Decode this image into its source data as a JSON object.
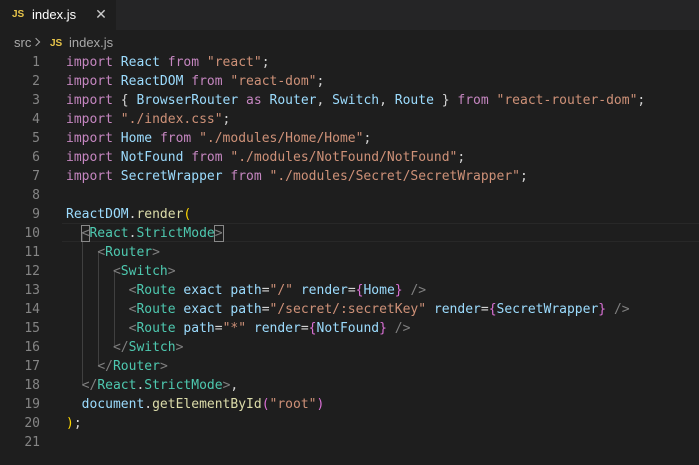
{
  "tab": {
    "icon_text": "JS",
    "label": "index.js",
    "close": "✕"
  },
  "breadcrumb": {
    "folder": "src",
    "icon_text": "JS",
    "file": "index.js"
  },
  "editor": {
    "line_numbers": [
      "1",
      "2",
      "3",
      "4",
      "5",
      "6",
      "7",
      "8",
      "9",
      "10",
      "11",
      "12",
      "13",
      "14",
      "15",
      "16",
      "17",
      "18",
      "19",
      "20",
      "21"
    ],
    "lines": [
      [
        [
          "import",
          "c"
        ],
        [
          " ",
          "d"
        ],
        [
          "React",
          "v"
        ],
        [
          " ",
          "d"
        ],
        [
          "from",
          "c"
        ],
        [
          " ",
          "d"
        ],
        [
          "\"react\"",
          "s"
        ],
        [
          ";",
          "d"
        ]
      ],
      [
        [
          "import",
          "c"
        ],
        [
          " ",
          "d"
        ],
        [
          "ReactDOM",
          "v"
        ],
        [
          " ",
          "d"
        ],
        [
          "from",
          "c"
        ],
        [
          " ",
          "d"
        ],
        [
          "\"react-dom\"",
          "s"
        ],
        [
          ";",
          "d"
        ]
      ],
      [
        [
          "import",
          "c"
        ],
        [
          " ",
          "d"
        ],
        [
          "{",
          "d"
        ],
        [
          " ",
          "d"
        ],
        [
          "BrowserRouter",
          "v"
        ],
        [
          " ",
          "d"
        ],
        [
          "as",
          "c"
        ],
        [
          " ",
          "d"
        ],
        [
          "Router",
          "v"
        ],
        [
          ", ",
          "d"
        ],
        [
          "Switch",
          "v"
        ],
        [
          ", ",
          "d"
        ],
        [
          "Route",
          "v"
        ],
        [
          " ",
          "d"
        ],
        [
          "}",
          "d"
        ],
        [
          " ",
          "d"
        ],
        [
          "from",
          "c"
        ],
        [
          " ",
          "d"
        ],
        [
          "\"react-router-dom\"",
          "s"
        ],
        [
          ";",
          "d"
        ]
      ],
      [
        [
          "import",
          "c"
        ],
        [
          " ",
          "d"
        ],
        [
          "\"./index.css\"",
          "s"
        ],
        [
          ";",
          "d"
        ]
      ],
      [
        [
          "import",
          "c"
        ],
        [
          " ",
          "d"
        ],
        [
          "Home",
          "v"
        ],
        [
          " ",
          "d"
        ],
        [
          "from",
          "c"
        ],
        [
          " ",
          "d"
        ],
        [
          "\"./modules/Home/Home\"",
          "s"
        ],
        [
          ";",
          "d"
        ]
      ],
      [
        [
          "import",
          "c"
        ],
        [
          " ",
          "d"
        ],
        [
          "NotFound",
          "v"
        ],
        [
          " ",
          "d"
        ],
        [
          "from",
          "c"
        ],
        [
          " ",
          "d"
        ],
        [
          "\"./modules/NotFound/NotFound\"",
          "s"
        ],
        [
          ";",
          "d"
        ]
      ],
      [
        [
          "import",
          "c"
        ],
        [
          " ",
          "d"
        ],
        [
          "SecretWrapper",
          "v"
        ],
        [
          " ",
          "d"
        ],
        [
          "from",
          "c"
        ],
        [
          " ",
          "d"
        ],
        [
          "\"./modules/Secret/SecretWrapper\"",
          "s"
        ],
        [
          ";",
          "d"
        ]
      ],
      [],
      [
        [
          "ReactDOM",
          "v"
        ],
        [
          ".",
          "d"
        ],
        [
          "render",
          "f"
        ],
        [
          "(",
          "y"
        ]
      ],
      [
        [
          "  ",
          "d"
        ],
        [
          "<",
          "p",
          "box"
        ],
        [
          "React",
          "t"
        ],
        [
          ".",
          "d"
        ],
        [
          "StrictMode",
          "t"
        ],
        [
          ">",
          "p",
          "box"
        ]
      ],
      [
        [
          "    ",
          "d"
        ],
        [
          "<",
          "p"
        ],
        [
          "Router",
          "t"
        ],
        [
          ">",
          "p"
        ]
      ],
      [
        [
          "      ",
          "d"
        ],
        [
          "<",
          "p"
        ],
        [
          "Switch",
          "t"
        ],
        [
          ">",
          "p"
        ]
      ],
      [
        [
          "        ",
          "d"
        ],
        [
          "<",
          "p"
        ],
        [
          "Route",
          "t"
        ],
        [
          " ",
          "d"
        ],
        [
          "exact",
          "v"
        ],
        [
          " ",
          "d"
        ],
        [
          "path",
          "v"
        ],
        [
          "=",
          "d"
        ],
        [
          "\"/\"",
          "s"
        ],
        [
          " ",
          "d"
        ],
        [
          "render",
          "v"
        ],
        [
          "=",
          "d"
        ],
        [
          "{",
          "m"
        ],
        [
          "Home",
          "v"
        ],
        [
          "}",
          "m"
        ],
        [
          " ",
          "d"
        ],
        [
          "/>",
          "p"
        ]
      ],
      [
        [
          "        ",
          "d"
        ],
        [
          "<",
          "p"
        ],
        [
          "Route",
          "t"
        ],
        [
          " ",
          "d"
        ],
        [
          "exact",
          "v"
        ],
        [
          " ",
          "d"
        ],
        [
          "path",
          "v"
        ],
        [
          "=",
          "d"
        ],
        [
          "\"/secret/:secretKey\"",
          "s"
        ],
        [
          " ",
          "d"
        ],
        [
          "render",
          "v"
        ],
        [
          "=",
          "d"
        ],
        [
          "{",
          "m"
        ],
        [
          "SecretWrapper",
          "v"
        ],
        [
          "}",
          "m"
        ],
        [
          " ",
          "d"
        ],
        [
          "/>",
          "p"
        ]
      ],
      [
        [
          "        ",
          "d"
        ],
        [
          "<",
          "p"
        ],
        [
          "Route",
          "t"
        ],
        [
          " ",
          "d"
        ],
        [
          "path",
          "v"
        ],
        [
          "=",
          "d"
        ],
        [
          "\"*\"",
          "s"
        ],
        [
          " ",
          "d"
        ],
        [
          "render",
          "v"
        ],
        [
          "=",
          "d"
        ],
        [
          "{",
          "m"
        ],
        [
          "NotFound",
          "v"
        ],
        [
          "}",
          "m"
        ],
        [
          " ",
          "d"
        ],
        [
          "/>",
          "p"
        ]
      ],
      [
        [
          "      ",
          "d"
        ],
        [
          "</",
          "p"
        ],
        [
          "Switch",
          "t"
        ],
        [
          ">",
          "p"
        ]
      ],
      [
        [
          "    ",
          "d"
        ],
        [
          "</",
          "p"
        ],
        [
          "Router",
          "t"
        ],
        [
          ">",
          "p"
        ]
      ],
      [
        [
          "  ",
          "d"
        ],
        [
          "</",
          "p"
        ],
        [
          "React",
          "t"
        ],
        [
          ".",
          "d"
        ],
        [
          "StrictMode",
          "t"
        ],
        [
          ">",
          "p"
        ],
        [
          ",",
          "d"
        ]
      ],
      [
        [
          "  ",
          "d"
        ],
        [
          "document",
          "v"
        ],
        [
          ".",
          "d"
        ],
        [
          "getElementById",
          "f"
        ],
        [
          "(",
          "m"
        ],
        [
          "\"root\"",
          "s"
        ],
        [
          ")",
          "m"
        ]
      ],
      [
        [
          ")",
          "y"
        ],
        [
          ";",
          "d"
        ]
      ],
      []
    ]
  },
  "colors": {
    "keyword_import": "#c586c0",
    "variable": "#9cdcfe",
    "string": "#ce9178",
    "function": "#dcdcaa",
    "jsx_tag": "#4ec9b0",
    "tag_bracket": "#808080",
    "bracket_gold": "#ffd700",
    "bracket_pink": "#da70d6",
    "line_number": "#858585",
    "background": "#1e1e1e",
    "js_icon": "#e8c54a"
  }
}
